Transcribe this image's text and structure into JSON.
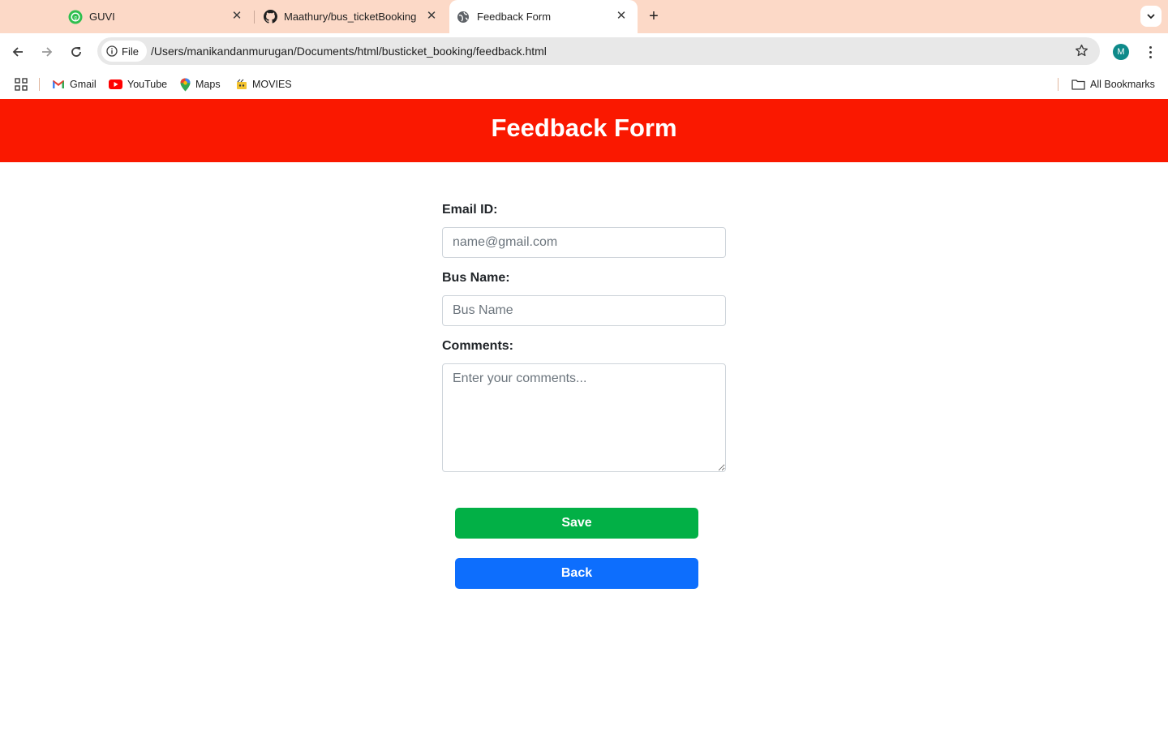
{
  "browser": {
    "tabs": [
      {
        "title": "GUVI",
        "icon": "guvi-favicon"
      },
      {
        "title": "Maathury/bus_ticketBooking",
        "icon": "github-favicon"
      },
      {
        "title": "Feedback Form",
        "icon": "globe-favicon",
        "active": true
      }
    ],
    "address": {
      "scheme_chip": "File",
      "url": "/Users/manikandanmurugan/Documents/html/busticket_booking/feedback.html"
    },
    "profile_initial": "M",
    "bookmarks": [
      {
        "label": "Gmail",
        "icon": "gmail-icon"
      },
      {
        "label": "YouTube",
        "icon": "youtube-icon"
      },
      {
        "label": "Maps",
        "icon": "maps-icon"
      },
      {
        "label": "MOVIES",
        "icon": "movies-icon"
      }
    ],
    "all_bookmarks_label": "All Bookmarks"
  },
  "page": {
    "header_title": "Feedback Form",
    "header_color": "#fa1800",
    "form": {
      "email_label": "Email ID:",
      "email_placeholder": "name@gmail.com",
      "email_value": "",
      "bus_label": "Bus Name:",
      "bus_placeholder": "Bus Name",
      "bus_value": "",
      "comments_label": "Comments:",
      "comments_placeholder": "Enter your comments...",
      "comments_value": ""
    },
    "save_label": "Save",
    "save_color": "#02b046",
    "back_label": "Back",
    "back_color": "#0d6efd"
  }
}
